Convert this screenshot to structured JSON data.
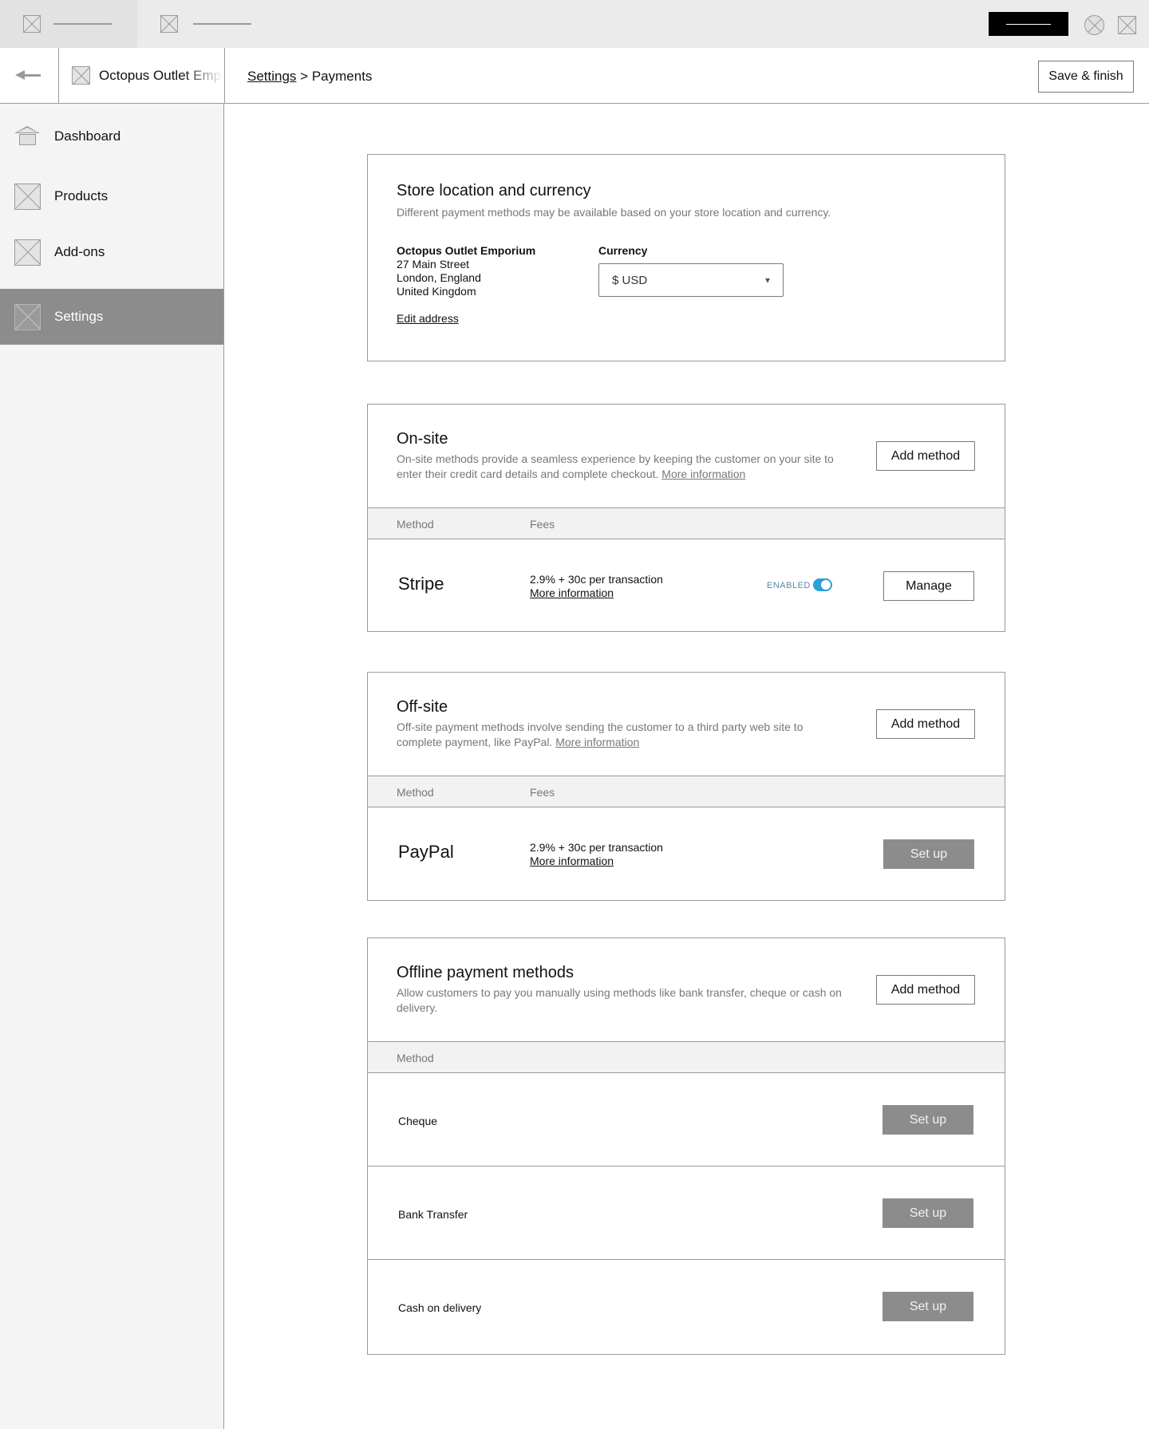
{
  "store": {
    "name": "Octopus Outlet Emporium"
  },
  "breadcrumb": {
    "parent": "Settings",
    "separator": ">",
    "current": "Payments"
  },
  "header": {
    "save_label": "Save & finish"
  },
  "sidebar": {
    "items": [
      {
        "label": "Dashboard",
        "icon": "home-icon"
      },
      {
        "label": "Products",
        "icon": "placeholder-icon"
      },
      {
        "label": "Add-ons",
        "icon": "placeholder-icon"
      },
      {
        "label": "Settings",
        "icon": "placeholder-icon",
        "active": true
      }
    ]
  },
  "location_card": {
    "title": "Store location and currency",
    "description": "Different payment methods may be available based on your store location and currency.",
    "address": {
      "name": "Octopus Outlet Emporium",
      "line1": "27 Main Street",
      "line2": "London, England",
      "line3": "United Kingdom"
    },
    "edit_address_label": "Edit address",
    "currency_label": "Currency",
    "currency_value": "$ USD"
  },
  "onsite_card": {
    "title": "On-site",
    "description": "On-site methods provide a seamless experience by keeping the customer on your site to enter their credit card details and complete checkout.",
    "more_info": "More information",
    "add_label": "Add method",
    "col_method": "Method",
    "col_fees": "Fees",
    "methods": [
      {
        "name": "Stripe",
        "fees": "2.9% + 30c per transaction",
        "more_info": "More information",
        "status": "ENABLED",
        "enabled": true,
        "action": "Manage"
      }
    ]
  },
  "offsite_card": {
    "title": "Off-site",
    "description": "Off-site payment methods involve sending the customer to a third party web site to complete payment, like PayPal.",
    "more_info": "More information",
    "add_label": "Add method",
    "col_method": "Method",
    "col_fees": "Fees",
    "methods": [
      {
        "name": "PayPal",
        "fees": "2.9% + 30c per transaction",
        "more_info": "More information",
        "action": "Set up"
      }
    ]
  },
  "offline_card": {
    "title": "Offline payment methods",
    "description": "Allow customers to pay you manually using methods like bank transfer, cheque or cash on delivery.",
    "add_label": "Add method",
    "col_method": "Method",
    "methods": [
      {
        "name": "Cheque",
        "action": "Set up"
      },
      {
        "name": "Bank Transfer",
        "action": "Set up"
      },
      {
        "name": "Cash on delivery",
        "action": "Set up"
      }
    ]
  },
  "colors": {
    "toggle_on": "#2a9fd8",
    "sidebar_active": "#8c8c8c",
    "setup_button": "#8c8c8c"
  }
}
